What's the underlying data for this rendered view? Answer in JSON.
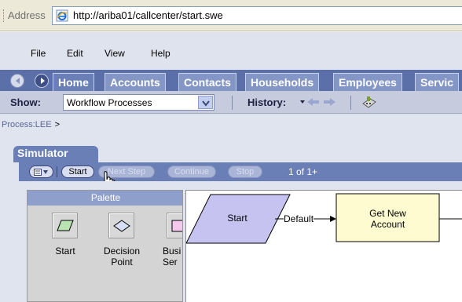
{
  "address_bar": {
    "label": "Address",
    "url": "http://ariba01/callcenter/start.swe"
  },
  "menu": [
    "File",
    "Edit",
    "View",
    "Help"
  ],
  "tabs": [
    {
      "label": "Home",
      "active": true
    },
    {
      "label": "Accounts"
    },
    {
      "label": "Contacts"
    },
    {
      "label": "Households"
    },
    {
      "label": "Employees"
    },
    {
      "label": "Servic"
    }
  ],
  "toolbar": {
    "show_label": "Show:",
    "show_value": "Workflow Processes",
    "history_label": "History:"
  },
  "breadcrumb": {
    "text": "Process:LEE",
    "sep": ">"
  },
  "simulator": {
    "title": "Simulator",
    "buttons": {
      "start": "Start",
      "next_step": "Next Step",
      "continue": "Continue",
      "stop": "Stop"
    },
    "counter": "1 of 1+"
  },
  "palette": {
    "title": "Palette",
    "items": [
      {
        "label": "Start",
        "icon": "parallelogram-icon"
      },
      {
        "label": "Decision\nPoint",
        "icon": "diamond-icon"
      },
      {
        "label": "Busi\nSer",
        "icon": "business-service-icon"
      }
    ]
  },
  "diagram": {
    "start_label": "Start",
    "edge_label": "Default",
    "step_label": "Get New\nAccount"
  },
  "colors": {
    "tab_bg": "#8496c6",
    "frame": "#6b7fb7",
    "start_fill": "#c7c3f0",
    "step_fill": "#fffbd0"
  }
}
